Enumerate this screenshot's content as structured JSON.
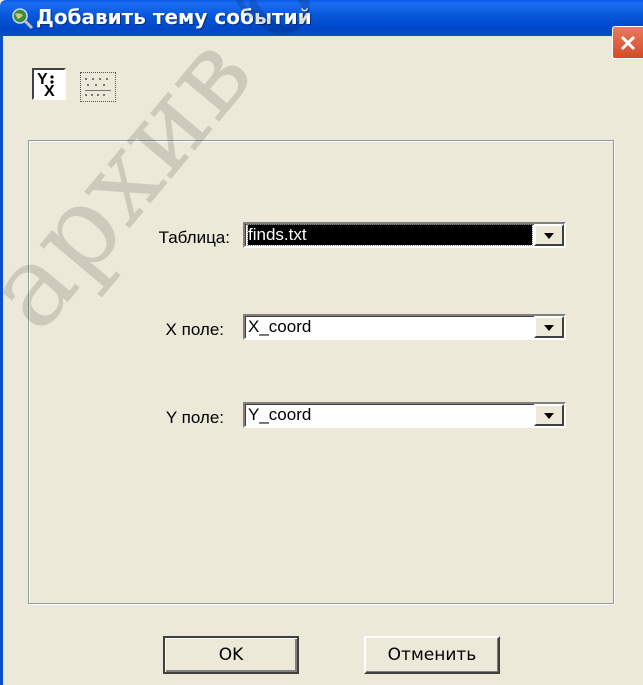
{
  "window": {
    "title": "Добавить тему событий",
    "icon": "globe-magnifier-icon"
  },
  "toolbar": {
    "xy_button_glyph": "Y:X",
    "table_button_glyph": "table-dots-icon"
  },
  "form": {
    "table_label": "Таблица:",
    "table_value": "finds.txt",
    "x_label": "X поле:",
    "x_value": "X_coord",
    "y_label": "Y поле:",
    "y_value": "Y_coord"
  },
  "buttons": {
    "ok": "OK",
    "cancel": "Отменить"
  },
  "watermark": "архив библио..."
}
